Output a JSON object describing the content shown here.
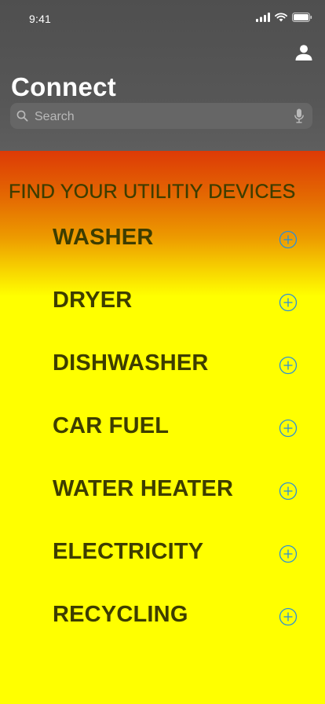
{
  "status_bar": {
    "time": "9:41"
  },
  "header": {
    "title": "Connect"
  },
  "search": {
    "placeholder": "Search"
  },
  "content": {
    "heading": "FIND YOUR UTILITIY DEVICES",
    "devices": [
      {
        "label": "WASHER"
      },
      {
        "label": "DRYER"
      },
      {
        "label": "DISHWASHER"
      },
      {
        "label": "CAR FUEL"
      },
      {
        "label": "WATER HEATER"
      },
      {
        "label": "ELECTRICITY"
      },
      {
        "label": "RECYCLING"
      }
    ]
  },
  "icons": {
    "signal": "signal-icon",
    "wifi": "wifi-icon",
    "battery": "battery-icon",
    "profile": "person-icon",
    "search": "search-icon",
    "mic": "microphone-icon",
    "add": "plus-circle-icon"
  },
  "colors": {
    "header_bg": "#555555",
    "accent_blue": "#2a8fd8",
    "text_dark": "#3d3d00",
    "content_bg": "#ffff00",
    "gradient_top": "#dd3a06"
  }
}
